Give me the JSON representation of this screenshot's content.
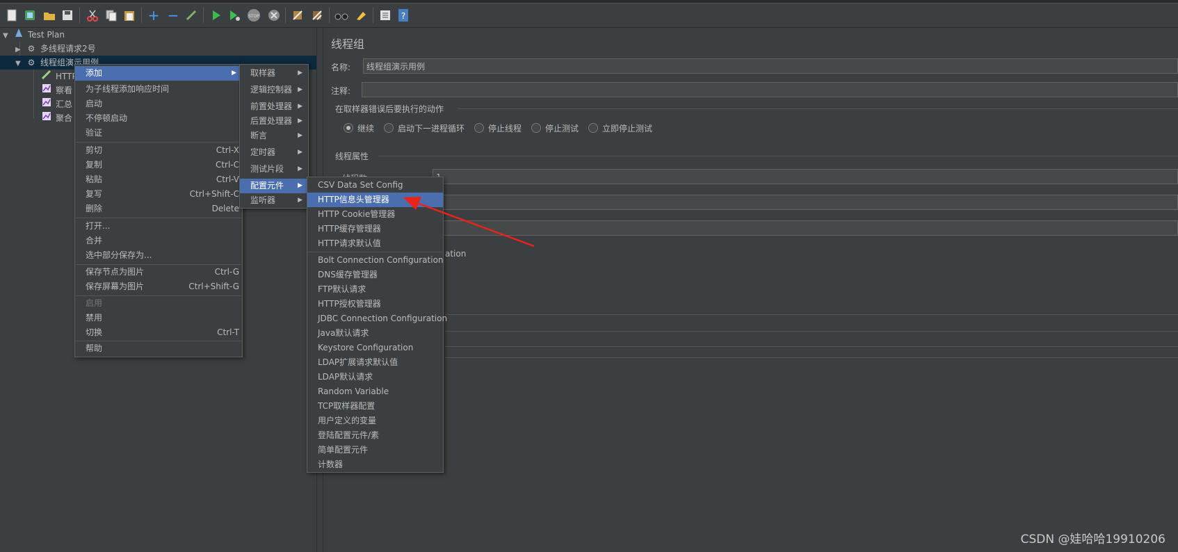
{
  "tree": {
    "root": "Test Plan",
    "nodes": [
      {
        "label": "多线程请求2号"
      },
      {
        "label": "线程组演示用例"
      },
      {
        "label": "HTTP"
      },
      {
        "label": "察看"
      },
      {
        "label": "汇总"
      },
      {
        "label": "聚合"
      }
    ]
  },
  "panel": {
    "title": "线程组",
    "name_label": "名称:",
    "name_value": "线程组演示用例",
    "comment_label": "注释:",
    "comment_value": "",
    "error_group_title": "在取样器错误后要执行的动作",
    "error_actions": [
      {
        "label": "继续",
        "selected": true
      },
      {
        "label": "启动下一进程循环",
        "selected": false
      },
      {
        "label": "停止线程",
        "selected": false
      },
      {
        "label": "停止测试",
        "selected": false
      },
      {
        "label": "立即停止测试",
        "selected": false
      }
    ],
    "thread_props_title": "线程属性",
    "thread_count_label": "线程数:",
    "thread_count_value": "1",
    "partial_text": "ation"
  },
  "context_menu": {
    "items": [
      {
        "label": "添加",
        "has_sub": true,
        "highlight": true
      },
      {
        "label": "为子线程添加响应时间"
      },
      {
        "label": "启动"
      },
      {
        "label": "不停顿启动"
      },
      {
        "label": "验证"
      },
      {
        "label": "剪切",
        "shortcut": "Ctrl-X"
      },
      {
        "label": "复制",
        "shortcut": "Ctrl-C"
      },
      {
        "label": "粘贴",
        "shortcut": "Ctrl-V"
      },
      {
        "label": "复写",
        "shortcut": "Ctrl+Shift-C"
      },
      {
        "label": "删除",
        "shortcut": "Delete"
      },
      {
        "label": "打开..."
      },
      {
        "label": "合并"
      },
      {
        "label": "选中部分保存为..."
      },
      {
        "label": "保存节点为图片",
        "shortcut": "Ctrl-G"
      },
      {
        "label": "保存屏幕为图片",
        "shortcut": "Ctrl+Shift-G"
      },
      {
        "label": "启用",
        "disabled": true
      },
      {
        "label": "禁用"
      },
      {
        "label": "切换",
        "shortcut": "Ctrl-T"
      },
      {
        "label": "帮助"
      }
    ]
  },
  "add_submenu": {
    "items": [
      {
        "label": "取样器"
      },
      {
        "label": "逻辑控制器"
      },
      {
        "label": "前置处理器"
      },
      {
        "label": "后置处理器"
      },
      {
        "label": "断言"
      },
      {
        "label": "定时器"
      },
      {
        "label": "测试片段"
      },
      {
        "label": "配置元件",
        "highlight": true
      },
      {
        "label": "监听器"
      }
    ]
  },
  "config_submenu": {
    "items": [
      {
        "label": "CSV Data Set Config"
      },
      {
        "label": "HTTP信息头管理器",
        "highlight": true
      },
      {
        "label": "HTTP Cookie管理器"
      },
      {
        "label": "HTTP缓存管理器"
      },
      {
        "label": "HTTP请求默认值"
      },
      {
        "label": "Bolt Connection Configuration"
      },
      {
        "label": "DNS缓存管理器"
      },
      {
        "label": "FTP默认请求"
      },
      {
        "label": "HTTP授权管理器"
      },
      {
        "label": "JDBC Connection Configuration"
      },
      {
        "label": "Java默认请求"
      },
      {
        "label": "Keystore Configuration"
      },
      {
        "label": "LDAP扩展请求默认值"
      },
      {
        "label": "LDAP默认请求"
      },
      {
        "label": "Random Variable"
      },
      {
        "label": "TCP取样器配置"
      },
      {
        "label": "用户定义的变量"
      },
      {
        "label": "登陆配置元件/素"
      },
      {
        "label": "简单配置元件"
      },
      {
        "label": "计数器"
      }
    ]
  },
  "watermark": "CSDN @娃哈哈19910206",
  "colors": {
    "background": "#3c3f41",
    "highlight": "#4b6eaf",
    "arrow": "#e8231a"
  },
  "toolbar_icons": [
    "new-icon",
    "templates-icon",
    "open-icon",
    "save-icon",
    "cut-icon",
    "copy-icon",
    "paste-icon",
    "expand-icon",
    "collapse-icon",
    "toggle-icon",
    "start-icon",
    "start-no-pause-icon",
    "stop-icon",
    "shutdown-icon",
    "clear-icon",
    "clear-all-icon",
    "search-icon",
    "reset-search-icon",
    "function-helper-icon",
    "help-icon"
  ]
}
